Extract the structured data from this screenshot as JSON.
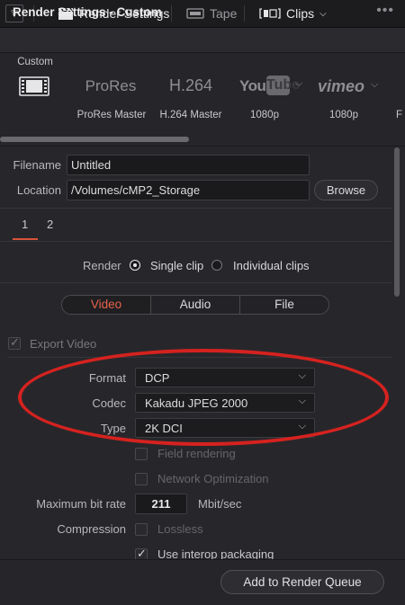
{
  "toolbar": {
    "render_settings": "Render Settings",
    "tape": "Tape",
    "clips": "Clips"
  },
  "header": {
    "title": "Render Settings - Custom",
    "menu": "•••"
  },
  "presets": [
    {
      "logo": "",
      "label": "Custom",
      "icon": "film-icon"
    },
    {
      "logo": "ProRes",
      "label": "ProRes Master"
    },
    {
      "logo": "H.264",
      "label": "H.264 Master"
    },
    {
      "logo": "YouTube",
      "label": "1080p"
    },
    {
      "logo": "vimeo",
      "label": "1080p"
    },
    {
      "logo": "",
      "label": "F"
    }
  ],
  "output": {
    "filename_label": "Filename",
    "filename_value": "Untitled",
    "location_label": "Location",
    "location_value": "/Volumes/cMP2_Storage",
    "browse_label": "Browse"
  },
  "pages": [
    "1",
    "2"
  ],
  "render_mode": {
    "label": "Render",
    "single_clip": "Single clip",
    "individual_clips": "Individual clips",
    "selected": "Single clip"
  },
  "tabs": [
    "Video",
    "Audio",
    "File"
  ],
  "active_tab": "Video",
  "video": {
    "export_video": "Export Video",
    "format_label": "Format",
    "format_value": "DCP",
    "codec_label": "Codec",
    "codec_value": "Kakadu JPEG 2000",
    "type_label": "Type",
    "type_value": "2K DCI",
    "field_rendering": "Field rendering",
    "network_optimization": "Network Optimization",
    "max_bit_rate_label": "Maximum bit rate",
    "max_bit_rate_value": "211",
    "max_bit_rate_unit": "Mbit/sec",
    "compression_label": "Compression",
    "lossless": "Lossless",
    "use_interop": "Use interop packaging"
  },
  "bottom": {
    "add_to_queue": "Add to Render Queue"
  },
  "colors": {
    "accent": "#e9634a",
    "annotation": "#d5221f"
  }
}
